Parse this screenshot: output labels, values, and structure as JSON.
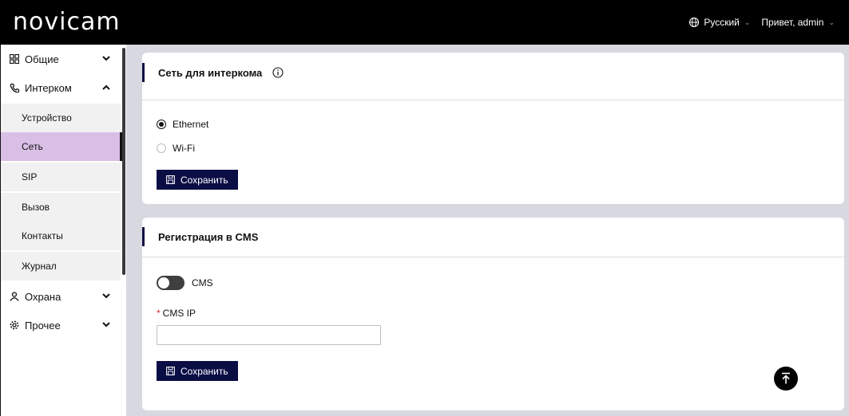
{
  "header": {
    "logo": "novicam",
    "language": "Русский",
    "greeting": "Привет, admin"
  },
  "sidebar": {
    "items": [
      {
        "label": "Общие",
        "icon": "grid-icon",
        "expanded": false
      },
      {
        "label": "Интерком",
        "icon": "phone-icon",
        "expanded": true,
        "children": [
          "Устройство",
          "Сеть",
          "SIP",
          "Вызов",
          "Контакты",
          "Журнал"
        ],
        "selected_child": "Сеть"
      },
      {
        "label": "Охрана",
        "icon": "person-icon",
        "expanded": false
      },
      {
        "label": "Прочее",
        "icon": "gear-icon",
        "expanded": false
      }
    ]
  },
  "network_card": {
    "title": "Сеть для интеркома",
    "options": [
      {
        "label": "Ethernet",
        "selected": true
      },
      {
        "label": "Wi-Fi",
        "selected": false
      }
    ],
    "save_label": "Сохранить"
  },
  "cms_card": {
    "title": "Регистрация в CMS",
    "toggle_label": "CMS",
    "toggle_on": false,
    "ip_label": "CMS IP",
    "ip_required_mark": "*",
    "ip_value": "",
    "save_label": "Сохранить"
  },
  "colors": {
    "header_bg": "#000000",
    "accent": "#0b0e45",
    "selected_nav": "#d9bfe6",
    "page_bg": "#d7d8e0",
    "required": "#e0242b"
  }
}
